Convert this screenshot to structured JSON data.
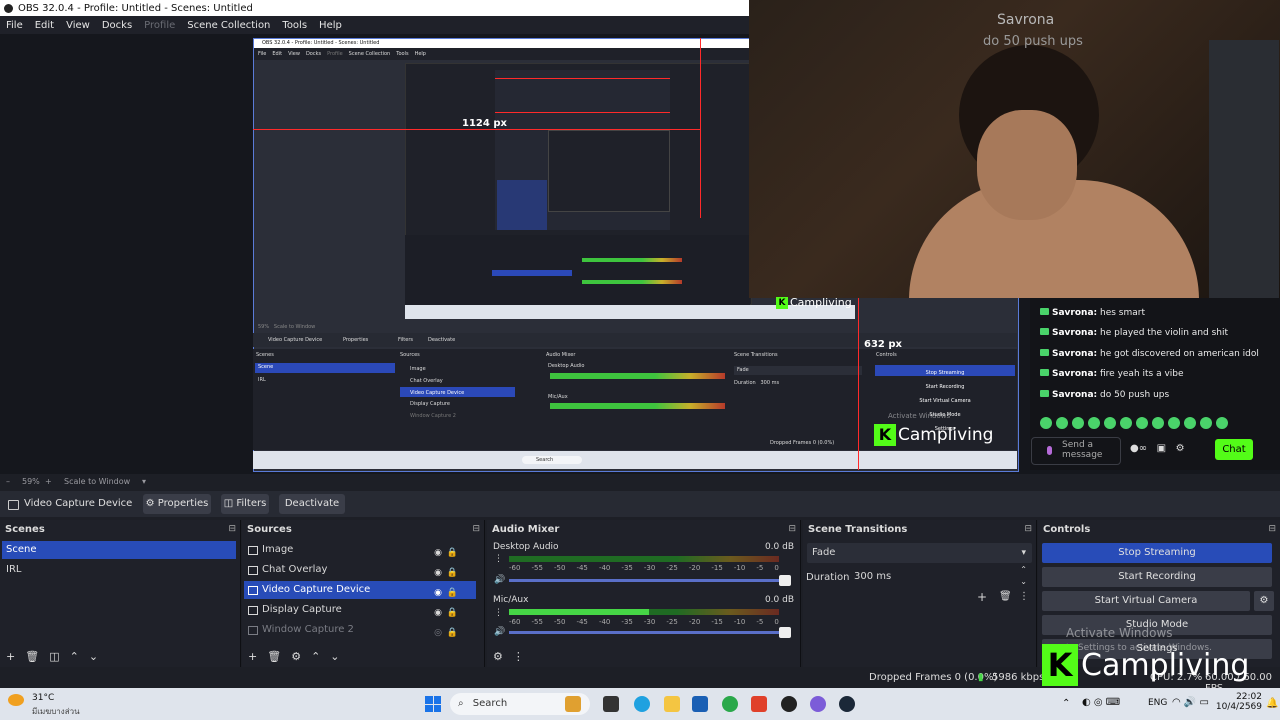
{
  "window": {
    "title": "OBS 32.0.4 - Profile: Untitled - Scenes: Untitled"
  },
  "menu": [
    "File",
    "Edit",
    "View",
    "Docks",
    "Profile",
    "Scene Collection",
    "Tools",
    "Help"
  ],
  "preview": {
    "width_label": "1124 px",
    "height_label": "632 px",
    "nested_menu": [
      "File",
      "Edit",
      "View",
      "Docks",
      "Profile",
      "Scene Collection",
      "Tools",
      "Help"
    ],
    "nested_source_name": "Video Capture Device",
    "nested_buttons": [
      "Properties",
      "Filters",
      "Deactivate"
    ],
    "nested_docks": [
      "Scenes",
      "Sources",
      "Audio Mixer",
      "Scene Transitions",
      "Controls"
    ],
    "nested_scenes": [
      "Scene",
      "IRL"
    ],
    "nested_sources": [
      "Image",
      "Chat Overlay",
      "Video Capture Device",
      "Display Capture",
      "Window Capture 2"
    ],
    "nested_mixer": [
      "Desktop Audio",
      "Mic/Aux"
    ],
    "nested_transition": "Fade",
    "nested_duration_label": "Duration",
    "nested_duration": "300 ms",
    "nested_controls": [
      "Stop Streaming",
      "Start Recording",
      "Start Virtual Camera",
      "Studio Mode",
      "Settings"
    ],
    "nested_status": "Dropped Frames 0 (0.0%)",
    "nested_zoom": "59%",
    "nested_scale": "Scale to Window",
    "nested_search": "Search",
    "nested_activate": "Activate Windows"
  },
  "webcam": {
    "chat_name": "Savrona",
    "chat_msg": "do 50 push ups"
  },
  "chat": {
    "messages": [
      {
        "user": "Savrona:",
        "text": "hes smart"
      },
      {
        "user": "Savrona:",
        "text": "he played the violin and shit"
      },
      {
        "user": "Savrona:",
        "text": "he got discovered on american idol"
      },
      {
        "user": "Savrona:",
        "text": "fire yeah its a vibe"
      },
      {
        "user": "Savrona:",
        "text": "do 50 push ups"
      }
    ],
    "send_placeholder": "Send a message",
    "send_label": "Chat",
    "overlay_top_label": "Campliving",
    "overlay_mid_label": "Campliving"
  },
  "zoom": {
    "percent": "59%",
    "scale_mode": "Scale to Window"
  },
  "source_toolbar": {
    "name": "Video Capture Device",
    "properties": "Properties",
    "filters": "Filters",
    "deactivate": "Deactivate"
  },
  "scenes": {
    "title": "Scenes",
    "items": [
      "Scene",
      "IRL"
    ]
  },
  "sources": {
    "title": "Sources",
    "items": [
      "Image",
      "Chat Overlay",
      "Video Capture Device",
      "Display Capture",
      "Window Capture 2"
    ]
  },
  "mixer": {
    "title": "Audio Mixer",
    "channels": [
      {
        "name": "Desktop Audio",
        "db": "0.0 dB",
        "level": 0.0
      },
      {
        "name": "Mic/Aux",
        "db": "0.0 dB",
        "level": 0.52
      }
    ],
    "ticks": [
      "-60",
      "-55",
      "-50",
      "-45",
      "-40",
      "-35",
      "-30",
      "-25",
      "-20",
      "-15",
      "-10",
      "-5",
      "0"
    ]
  },
  "transitions": {
    "title": "Scene Transitions",
    "selected": "Fade",
    "duration_label": "Duration",
    "duration": "300 ms"
  },
  "controls": {
    "title": "Controls",
    "stop_streaming": "Stop Streaming",
    "start_recording": "Start Recording",
    "start_virtual_camera": "Start Virtual Camera",
    "studio_mode": "Studio Mode",
    "settings": "Settings",
    "activate_title": "Activate Windows",
    "activate_sub": "to Settings to activate Windows."
  },
  "status": {
    "dropped": "Dropped Frames 0 (0.0%)",
    "bitrate": "5986 kbps",
    "cpu": "CPU: 2.7%",
    "fps": "60.00 / 60.00 FPS",
    "brand": "Campliving"
  },
  "taskbar": {
    "weather_temp": "31°C",
    "weather_desc": "มีเมฆบางส่วน",
    "search": "Search",
    "lang": "ENG",
    "time": "22:02",
    "date": "10/4/2569"
  },
  "colors": {
    "accent": "#284cb8",
    "kick_green": "#53fc18",
    "guide_red": "#ff2a2a"
  }
}
